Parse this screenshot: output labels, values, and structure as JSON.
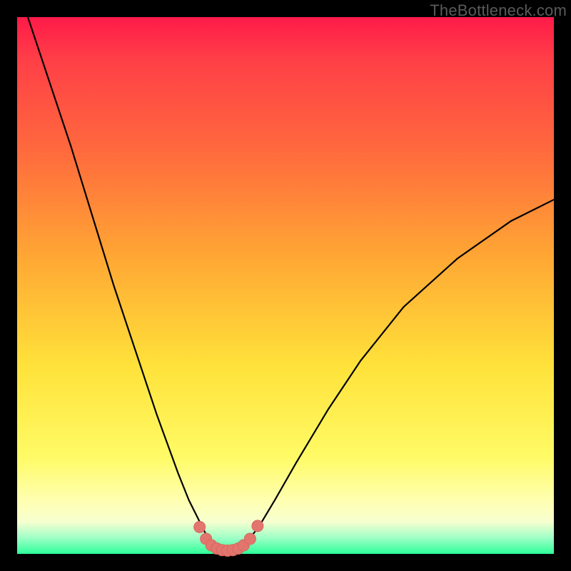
{
  "watermark": "TheBottleneck.com",
  "colors": {
    "curve_stroke": "#000000",
    "marker_fill": "#e2756d",
    "marker_stroke": "#d8675f",
    "gradient_top": "#ff1a49",
    "gradient_mid": "#ffe23a",
    "gradient_bottom": "#2dff9a",
    "frame": "#000000"
  },
  "chart_data": {
    "type": "line",
    "title": "",
    "xlabel": "",
    "ylabel": "",
    "xlim": [
      0,
      100
    ],
    "ylim": [
      0,
      100
    ],
    "grid": false,
    "series": [
      {
        "name": "bottleneck-curve",
        "x": [
          2,
          6,
          10,
          14,
          18,
          22,
          26,
          30,
          32,
          34,
          35,
          36,
          37,
          38,
          39,
          40,
          41,
          42,
          43,
          45,
          48,
          52,
          58,
          64,
          72,
          82,
          92,
          100
        ],
        "y": [
          100,
          88,
          76,
          63,
          50,
          38,
          26,
          15,
          10,
          6,
          4,
          2.2,
          1.2,
          0.7,
          0.6,
          0.6,
          0.8,
          1.4,
          2.5,
          5,
          10,
          17,
          27,
          36,
          46,
          55,
          62,
          66
        ]
      }
    ],
    "markers": {
      "name": "bottom-dots",
      "x": [
        34.0,
        35.2,
        36.2,
        37.2,
        38.2,
        39.2,
        40.2,
        41.2,
        42.2,
        43.4,
        44.8
      ],
      "y": [
        5.0,
        2.8,
        1.6,
        1.0,
        0.7,
        0.6,
        0.7,
        1.0,
        1.6,
        2.8,
        5.2
      ],
      "r": 8
    }
  }
}
